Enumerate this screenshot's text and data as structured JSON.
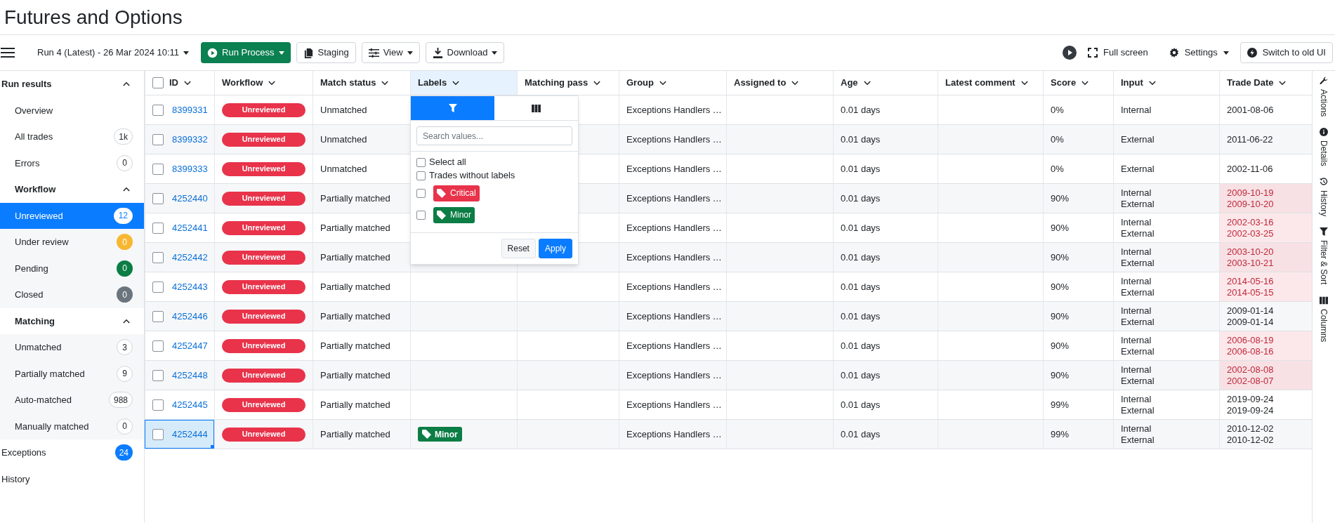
{
  "page_title": "Futures and Options",
  "toolbar": {
    "run_selector": "Run 4 (Latest) - 26 Mar 2024 10:11",
    "buttons": [
      {
        "kind": "primary",
        "label": "Run Process",
        "caret": true
      },
      {
        "kind": "staging",
        "label": "Staging",
        "caret": false
      },
      {
        "kind": "view",
        "label": "View",
        "caret": true
      },
      {
        "kind": "download",
        "label": "Download",
        "caret": true
      }
    ],
    "right": [
      {
        "kind": "play"
      },
      {
        "kind": "fullscreen",
        "label": "Full screen"
      },
      {
        "kind": "settings",
        "label": "Settings",
        "caret": true
      },
      {
        "kind": "switch",
        "label": "Switch to old UI"
      }
    ]
  },
  "sidebar": {
    "sections": [
      {
        "title": "Run results",
        "expanded": true,
        "items": [
          {
            "label": "Overview",
            "selected": false
          },
          {
            "label": "All trades",
            "count": "1k",
            "selected": false
          },
          {
            "label": "Errors",
            "count": "0",
            "selected": false
          }
        ],
        "subsections": [
          {
            "title": "Workflow",
            "expanded": true,
            "items": [
              {
                "label": "Unreviewed",
                "count": "12",
                "selected": true
              },
              {
                "label": "Under review",
                "count": "0",
                "color": "#f7b731",
                "selected": false
              },
              {
                "label": "Pending",
                "count": "0",
                "color": "#0b7d45",
                "selected": false
              },
              {
                "label": "Closed",
                "count": "0",
                "color": "#6c757d",
                "selected": false
              }
            ]
          },
          {
            "title": "Matching",
            "expanded": true,
            "items": [
              {
                "label": "Unmatched",
                "count": "3",
                "selected": false
              },
              {
                "label": "Partially matched",
                "count": "9",
                "selected": false
              },
              {
                "label": "Auto-matched",
                "count": "988",
                "selected": false
              },
              {
                "label": "Manually matched",
                "count": "0",
                "selected": false
              }
            ]
          }
        ]
      }
    ],
    "links": [
      {
        "label": "Exceptions",
        "count": "24",
        "color": "#0a7cff",
        "selected": false
      },
      {
        "label": "History",
        "selected": false
      }
    ]
  },
  "table": {
    "columns": [
      {
        "label": "ID",
        "active": false
      },
      {
        "label": "Workflow",
        "active": false
      },
      {
        "label": "Match status",
        "active": false
      },
      {
        "label": "Labels",
        "active": true
      },
      {
        "label": "Matching pass",
        "active": false
      },
      {
        "label": "Group",
        "active": false
      },
      {
        "label": "Assigned to",
        "active": false
      },
      {
        "label": "Age",
        "active": false
      },
      {
        "label": "Latest comment",
        "active": false
      },
      {
        "label": "Score",
        "active": false
      },
      {
        "label": "Input",
        "active": false
      },
      {
        "label": "Trade Date",
        "active": false
      }
    ],
    "rows": [
      {
        "id": "8399331",
        "workflow": "Unreviewed",
        "match_status": "Unmatched",
        "group": "Exceptions Handlers …",
        "age": "0.01 days",
        "score": "0%",
        "input": [
          "Internal"
        ],
        "trade_date": [
          "2001-08-06"
        ],
        "date_mismatch": false,
        "selected": false
      },
      {
        "id": "8399332",
        "workflow": "Unreviewed",
        "match_status": "Unmatched",
        "group": "Exceptions Handlers …",
        "age": "0.01 days",
        "score": "0%",
        "input": [
          "External"
        ],
        "trade_date": [
          "2011-06-22"
        ],
        "date_mismatch": false,
        "selected": false
      },
      {
        "id": "8399333",
        "workflow": "Unreviewed",
        "match_status": "Unmatched",
        "group": "Exceptions Handlers …",
        "age": "0.01 days",
        "score": "0%",
        "input": [
          "External"
        ],
        "trade_date": [
          "2002-11-06"
        ],
        "date_mismatch": false,
        "selected": false
      },
      {
        "id": "4252440",
        "workflow": "Unreviewed",
        "match_status": "Partially matched",
        "group": "Exceptions Handlers …",
        "age": "0.01 days",
        "score": "90%",
        "input": [
          "Internal",
          "External"
        ],
        "trade_date": [
          "2009-10-19",
          "2009-10-20"
        ],
        "date_mismatch": true,
        "selected": false
      },
      {
        "id": "4252441",
        "workflow": "Unreviewed",
        "match_status": "Partially matched",
        "group": "Exceptions Handlers …",
        "age": "0.01 days",
        "score": "90%",
        "input": [
          "Internal",
          "External"
        ],
        "trade_date": [
          "2002-03-16",
          "2002-03-25"
        ],
        "date_mismatch": true,
        "selected": false
      },
      {
        "id": "4252442",
        "workflow": "Unreviewed",
        "match_status": "Partially matched",
        "group": "Exceptions Handlers …",
        "age": "0.01 days",
        "score": "90%",
        "input": [
          "Internal",
          "External"
        ],
        "trade_date": [
          "2003-10-20",
          "2003-10-21"
        ],
        "date_mismatch": true,
        "selected": false
      },
      {
        "id": "4252443",
        "workflow": "Unreviewed",
        "match_status": "Partially matched",
        "group": "Exceptions Handlers …",
        "age": "0.01 days",
        "score": "90%",
        "input": [
          "Internal",
          "External"
        ],
        "trade_date": [
          "2014-05-16",
          "2014-05-15"
        ],
        "date_mismatch": true,
        "selected": false
      },
      {
        "id": "4252446",
        "workflow": "Unreviewed",
        "match_status": "Partially matched",
        "group": "Exceptions Handlers …",
        "age": "0.01 days",
        "score": "90%",
        "input": [
          "Internal",
          "External"
        ],
        "trade_date": [
          "2009-01-14",
          "2009-01-14"
        ],
        "date_mismatch": false,
        "selected": false
      },
      {
        "id": "4252447",
        "workflow": "Unreviewed",
        "match_status": "Partially matched",
        "group": "Exceptions Handlers …",
        "age": "0.01 days",
        "score": "90%",
        "input": [
          "Internal",
          "External"
        ],
        "trade_date": [
          "2006-08-19",
          "2006-08-16"
        ],
        "date_mismatch": true,
        "selected": false
      },
      {
        "id": "4252448",
        "workflow": "Unreviewed",
        "match_status": "Partially matched",
        "group": "Exceptions Handlers …",
        "age": "0.01 days",
        "score": "90%",
        "input": [
          "Internal",
          "External"
        ],
        "trade_date": [
          "2002-08-08",
          "2002-08-07"
        ],
        "date_mismatch": true,
        "selected": false
      },
      {
        "id": "4252445",
        "workflow": "Unreviewed",
        "match_status": "Partially matched",
        "group": "Exceptions Handlers …",
        "age": "0.01 days",
        "score": "99%",
        "input": [
          "Internal",
          "External"
        ],
        "trade_date": [
          "2019-09-24",
          "2019-09-24"
        ],
        "date_mismatch": false,
        "selected": false
      },
      {
        "id": "4252444",
        "workflow": "Unreviewed",
        "match_status": "Partially matched",
        "labels": [
          {
            "label": "Minor",
            "color": "#0b7d45"
          }
        ],
        "group": "Exceptions Handlers …",
        "age": "0.01 days",
        "score": "99%",
        "input": [
          "Internal",
          "External"
        ],
        "trade_date": [
          "2010-12-02",
          "2010-12-02"
        ],
        "date_mismatch": false,
        "selected": true
      }
    ]
  },
  "filter_popup": {
    "tabs": [
      {
        "kind": "filter",
        "selected": true
      },
      {
        "kind": "columns",
        "selected": false
      }
    ],
    "search": {
      "placeholder": "Search values..."
    },
    "options": [
      {
        "kind": "text",
        "label": "Select all",
        "checked": false
      },
      {
        "kind": "text",
        "label": "Trades without labels",
        "checked": false
      },
      {
        "kind": "tag",
        "label": "Critical",
        "color": "#e8334a",
        "checked": false
      },
      {
        "kind": "tag",
        "label": "Minor",
        "color": "#0b7d45",
        "checked": false
      }
    ],
    "buttons": [
      {
        "kind": "reset",
        "label": "Reset"
      },
      {
        "kind": "apply",
        "label": "Apply"
      }
    ]
  },
  "right_rail": [
    {
      "kind": "wrench",
      "label": "Actions"
    },
    {
      "kind": "info",
      "label": "Details"
    },
    {
      "kind": "history",
      "label": "History"
    },
    {
      "kind": "filter",
      "label": "Filter & Sort"
    },
    {
      "kind": "columns",
      "label": "Columns"
    }
  ]
}
